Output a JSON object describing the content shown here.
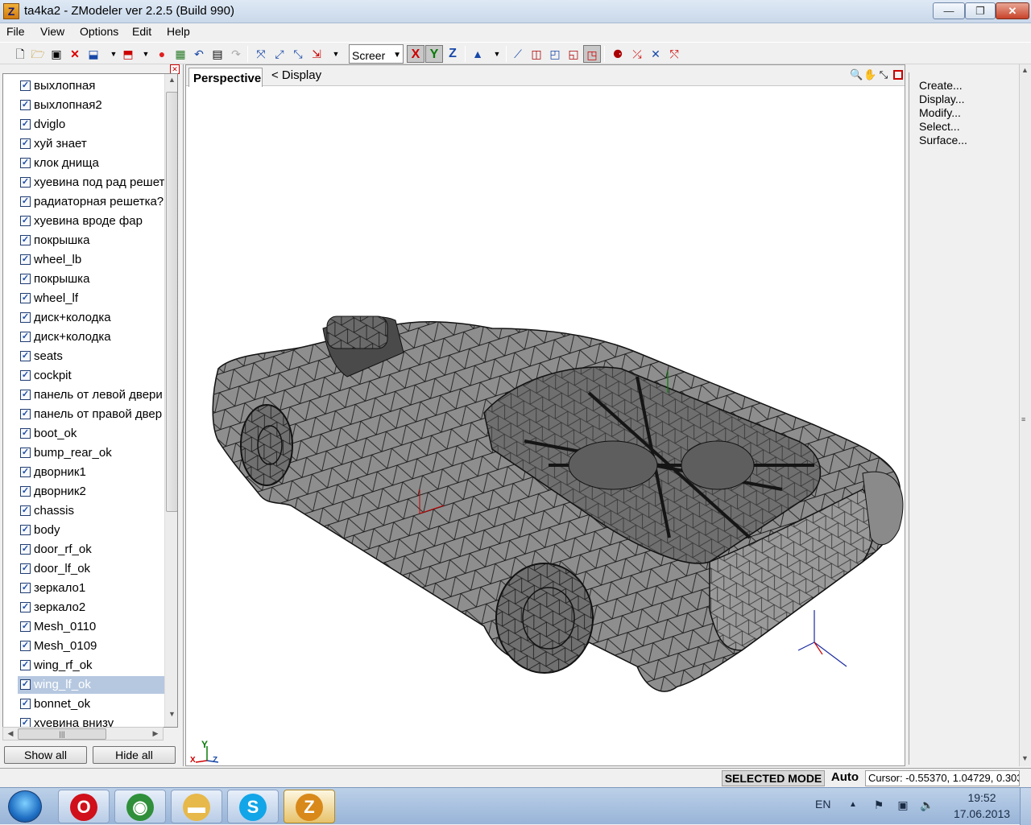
{
  "window": {
    "title": "ta4ka2 - ZModeler ver 2.2.5 (Build 990)",
    "app_icon_glyph": "Z",
    "minimize_glyph": "—",
    "maximize_glyph": "❐",
    "close_glyph": "✕"
  },
  "menu": {
    "file": "File",
    "view": "View",
    "options": "Options",
    "edit": "Edit",
    "help": "Help"
  },
  "toolbar": {
    "screen_select_value": "Screer",
    "axis_x": "X",
    "axis_y": "Y",
    "axis_z": "Z",
    "icons": [
      "new-file-icon",
      "open-file-icon",
      "save-icon",
      "delete-icon",
      "import-icon",
      "export-icon",
      "undo-icon",
      "redo-icon",
      "snap-icon",
      "move-icon",
      "rotate-icon",
      "scale-icon"
    ]
  },
  "objects": {
    "items": [
      {
        "label": "выхлопная",
        "checked": true
      },
      {
        "label": "выхлопная2",
        "checked": true
      },
      {
        "label": "dviglo",
        "checked": true
      },
      {
        "label": "хуй знает",
        "checked": true
      },
      {
        "label": "клок днища",
        "checked": true
      },
      {
        "label": "хуевина под рад решет",
        "checked": true
      },
      {
        "label": "радиаторная решетка?",
        "checked": true
      },
      {
        "label": "хуевина вроде фар",
        "checked": true
      },
      {
        "label": "покрышка",
        "checked": true
      },
      {
        "label": "wheel_lb",
        "checked": true
      },
      {
        "label": "покрышка",
        "checked": true
      },
      {
        "label": "wheel_lf",
        "checked": true
      },
      {
        "label": "диск+колодка",
        "checked": true
      },
      {
        "label": "диск+колодка",
        "checked": true
      },
      {
        "label": "seats",
        "checked": true
      },
      {
        "label": "cockpit",
        "checked": true
      },
      {
        "label": "панель от левой двери",
        "checked": true
      },
      {
        "label": "панель от правой двер",
        "checked": true
      },
      {
        "label": "boot_ok",
        "checked": true
      },
      {
        "label": "bump_rear_ok",
        "checked": true
      },
      {
        "label": "дворник1",
        "checked": true
      },
      {
        "label": "дворник2",
        "checked": true
      },
      {
        "label": "chassis",
        "checked": true
      },
      {
        "label": "body",
        "checked": true
      },
      {
        "label": "door_rf_ok",
        "checked": true
      },
      {
        "label": "door_lf_ok",
        "checked": true
      },
      {
        "label": "зеркало1",
        "checked": true
      },
      {
        "label": "зеркало2",
        "checked": true
      },
      {
        "label": "Mesh_0110",
        "checked": true
      },
      {
        "label": "Mesh_0109",
        "checked": true
      },
      {
        "label": "wing_rf_ok",
        "checked": true
      },
      {
        "label": "wing_lf_ok",
        "checked": true,
        "selected": true
      },
      {
        "label": "bonnet_ok",
        "checked": true
      },
      {
        "label": "хуевина внизу",
        "checked": true
      }
    ],
    "show_all": "Show all",
    "hide_all": "Hide all"
  },
  "viewport": {
    "tab": "Perspective",
    "crumb": "<  Display",
    "axis_y_label": "Y",
    "axis_x_label": "X",
    "axis_z_label": "Z"
  },
  "commands": {
    "items": [
      "Create...",
      "Display...",
      "Modify...",
      "Select...",
      "Surface..."
    ]
  },
  "status": {
    "mode": "SELECTED MODE",
    "auto": "Auto",
    "cursor": "Cursor: -0.55370, 1.04729, 0.303"
  },
  "taskbar": {
    "apps": [
      {
        "name": "opera",
        "glyph": "O",
        "color": "#d0101a",
        "active": false
      },
      {
        "name": "chrome",
        "glyph": "◉",
        "color": "#2f8f3a",
        "active": false
      },
      {
        "name": "explorer",
        "glyph": "▬",
        "color": "#e7b84a",
        "active": false
      },
      {
        "name": "skype",
        "glyph": "S",
        "color": "#12a5e8",
        "active": false
      },
      {
        "name": "zmodeler",
        "glyph": "Z",
        "color": "#d8891a",
        "active": true
      }
    ],
    "language": "EN",
    "time": "19:52",
    "date": "17.06.2013"
  }
}
